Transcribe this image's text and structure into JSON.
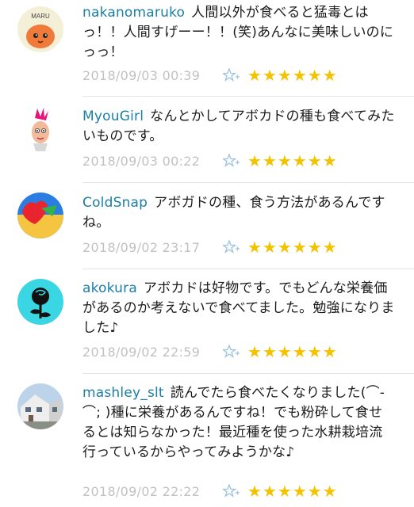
{
  "comments": [
    {
      "username": "nakanomaruko",
      "text": "人間以外が食べると猛毒とはっ！！人間すげーー！！(笑)あんなに美味しいのにっっ！",
      "timestamp": "2018/09/03 00:39",
      "avatar_label": "MARU",
      "rating": 6
    },
    {
      "username": "MyouGirl",
      "text": "なんとかしてアボカドの種も食べてみたいものです。",
      "timestamp": "2018/09/03 00:22",
      "rating": 6
    },
    {
      "username": "ColdSnap",
      "text": "アボガドの種、食う方法があるんですね。",
      "timestamp": "2018/09/02 23:17",
      "rating": 6
    },
    {
      "username": "akokura",
      "text": "アボカドは好物です。でもどんな栄養価があるのか考えないで食べてました。勉強になりました♪",
      "timestamp": "2018/09/02 22:59",
      "rating": 6
    },
    {
      "username": "mashley_slt",
      "text": "読んでたら食べたくなりました(⌒-⌒; )種に栄養があるんですね！でも粉砕して食せるとは知らなかった！最近種を使った水耕栽培流行っているからやってみようかな♪",
      "timestamp": "2018/09/02 22:22",
      "rating": 6
    }
  ],
  "colors": {
    "username": "#1a7fa6",
    "timestamp": "#c2c2c2",
    "star": "#f4c300",
    "fav_icon": "#9cc3e0"
  },
  "icons": {
    "fav": "star-plus-icon",
    "rating": "star-icon"
  }
}
